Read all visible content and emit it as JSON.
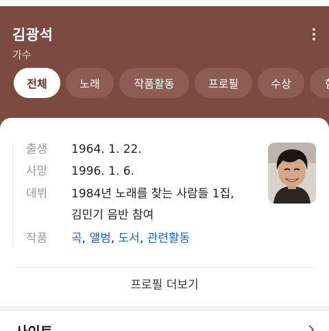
{
  "header": {
    "title": "김광석",
    "subtitle": "가수",
    "menu_icon": "more-vertical-icon",
    "background_color": "#7c4a3e"
  },
  "tabs": [
    {
      "label": "전체",
      "active": true
    },
    {
      "label": "노래",
      "active": false
    },
    {
      "label": "작품활동",
      "active": false
    },
    {
      "label": "프로필",
      "active": false
    },
    {
      "label": "수상",
      "active": false
    },
    {
      "label": "함께",
      "active": false
    }
  ],
  "profile": {
    "birth_label": "출생",
    "birth_value": "1964. 1. 22.",
    "death_label": "사망",
    "death_value": "1996. 1. 6.",
    "debut_label": "데뷔",
    "debut_value_line1": "1984년 노래를 찾는 사람들 1집,",
    "debut_value_line2": "김민기 음반 참여",
    "works_label": "작품",
    "works_links": [
      "곡",
      "앨범",
      "도서",
      "관련활동"
    ],
    "works_separator": ",",
    "photo_icon": "person-portrait"
  },
  "profile_more_label": "프로필 더보기",
  "site_section": {
    "title": "사이트",
    "chevron_icon": "chevron-right-icon"
  },
  "colors": {
    "link": "#1a63c6",
    "label": "#9a9a9a",
    "tab_active_text": "#5a2f25"
  }
}
